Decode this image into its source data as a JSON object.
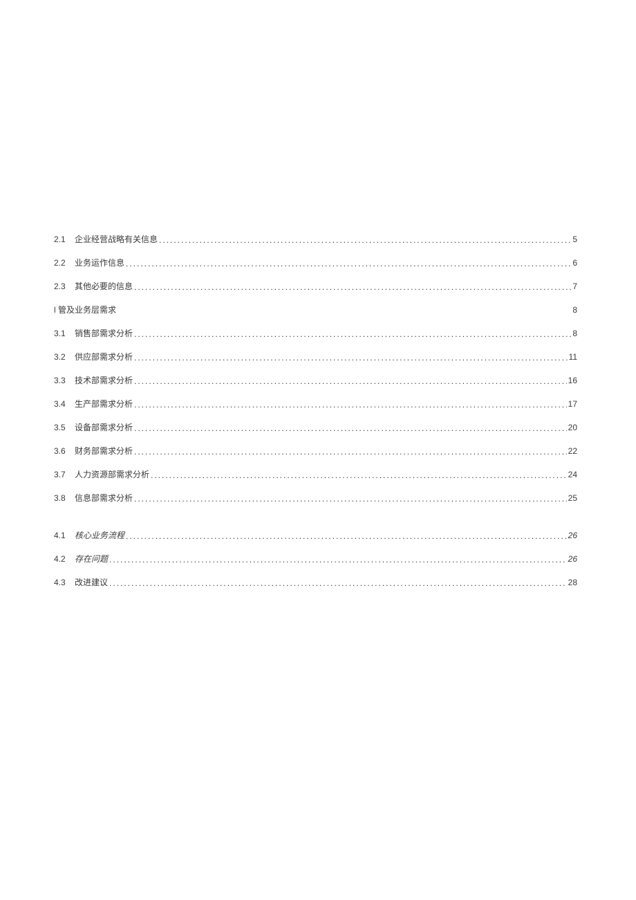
{
  "group1": [
    {
      "num": "2.1",
      "title": "企业经营战略有关信息",
      "page": "5"
    },
    {
      "num": "2.2",
      "title": "业务运作信息",
      "page": "6"
    },
    {
      "num": "2.3",
      "title": "其他必要的信息",
      "page": "7"
    }
  ],
  "sectionHeading": {
    "title": "l 管及业务层需求",
    "page": "8"
  },
  "group2": [
    {
      "num": "3.1",
      "title": "销售部需求分析",
      "page": "8"
    },
    {
      "num": "3.2",
      "title": "供应部需求分析",
      "page": "11"
    },
    {
      "num": "3.3",
      "title": "技术部需求分析",
      "page": "16"
    },
    {
      "num": "3.4",
      "title": "生产部需求分析",
      "page": "17"
    },
    {
      "num": "3.5",
      "title": "设备部需求分析",
      "page": "20"
    },
    {
      "num": "3.6",
      "title": "财务部需求分析",
      "page": "22"
    },
    {
      "num": "3.7",
      "title": "人力资源部需求分析",
      "page": "24"
    },
    {
      "num": "3.8",
      "title": "信息部需求分析",
      "page": "25"
    }
  ],
  "group3": [
    {
      "num": "4.1",
      "title": "核心业务流程",
      "page": "26",
      "italic": true
    },
    {
      "num": "4.2",
      "title": "存在问题",
      "page": "26",
      "italic": true
    },
    {
      "num": "4.3",
      "title": "改进建议",
      "page": "28",
      "italic": false
    }
  ]
}
